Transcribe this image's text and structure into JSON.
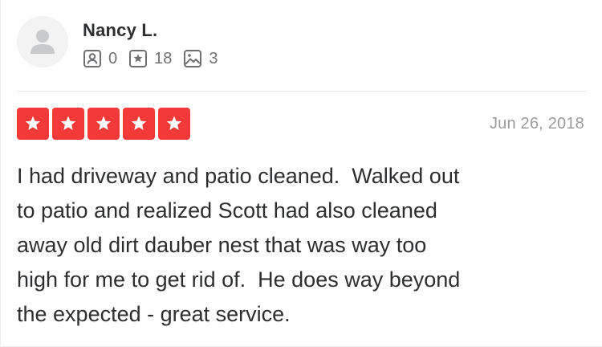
{
  "reviewer": {
    "name": "Nancy L.",
    "avatar_icon": "default-user-silhouette-icon",
    "stats": {
      "friends": "0",
      "reviews": "18",
      "photos": "3"
    },
    "stat_icons": [
      "friends-icon",
      "reviews-star-icon",
      "photos-icon"
    ]
  },
  "review": {
    "rating": 5,
    "rating_max": 5,
    "star_color": "#f43939",
    "date": "Jun 26, 2018",
    "text_lines": [
      "I had driveway and patio cleaned.  Walked out",
      "to patio and realized Scott had also cleaned",
      "away old dirt dauber nest that was way too",
      "high for me to get rid of.  He does way beyond",
      "the expected - great service."
    ]
  }
}
